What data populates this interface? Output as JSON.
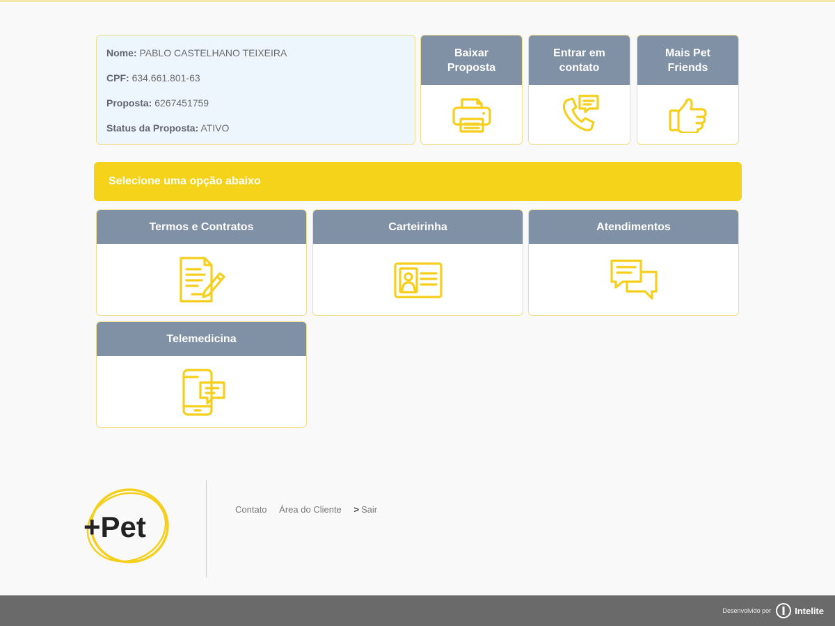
{
  "info": {
    "nome_label": "Nome:",
    "nome_value": "PABLO CASTELHANO TEIXEIRA",
    "cpf_label": "CPF:",
    "cpf_value": "634.661.801-63",
    "proposta_label": "Proposta:",
    "proposta_value": "6267451759",
    "status_label": "Status da Proposta:",
    "status_value": "ATIVO"
  },
  "actions": [
    {
      "label": "Baixar Proposta",
      "icon": "printer-icon"
    },
    {
      "label": "Entrar em contato",
      "icon": "phone-chat-icon"
    },
    {
      "label": "Mais Pet Friends",
      "icon": "thumbs-up-icon"
    }
  ],
  "banner": {
    "text": "Selecione uma opção abaixo"
  },
  "options": [
    {
      "label": "Termos e Contratos",
      "icon": "document-pen-icon"
    },
    {
      "label": "Carteirinha",
      "icon": "id-card-icon"
    },
    {
      "label": "Atendimentos",
      "icon": "chat-bubbles-icon"
    },
    {
      "label": "Telemedicina",
      "icon": "phone-message-icon"
    }
  ],
  "footer": {
    "logo_text": "+Pet",
    "links": [
      "Contato",
      "Área do Cliente",
      "Sair"
    ],
    "sair_arrow": ">",
    "developed_by": "Desenvolvido por",
    "developer": "Intelite"
  },
  "colors": {
    "accent": "#f5d31a",
    "card_header": "#8090a5",
    "info_bg": "#eef6fd",
    "footer_bar": "#6a6a6a"
  }
}
